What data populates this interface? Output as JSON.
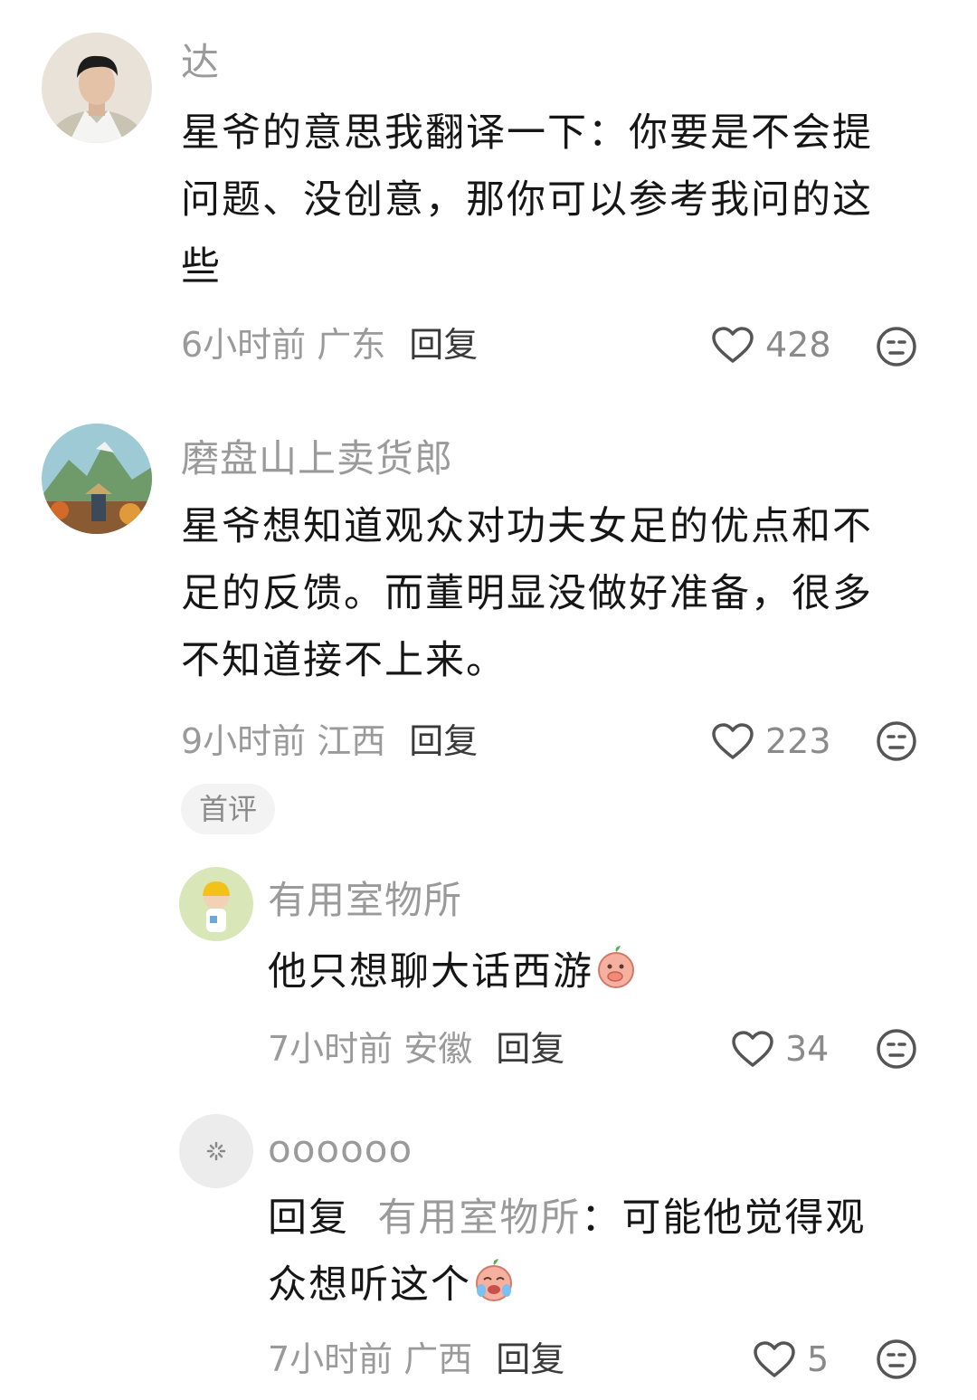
{
  "comments": [
    {
      "author": "达",
      "lines": [
        "星爷的意思我翻译一下：你要是不会提",
        "问题、没创意，那你可以参考我问的这",
        "些"
      ],
      "time_location": "6小时前 广东",
      "reply_label": "回复",
      "likes": "428"
    },
    {
      "author": "磨盘山上卖货郎",
      "lines": [
        "星爷想知道观众对功夫女足的优点和不",
        "足的反馈。而董明显没做好准备，很多",
        "不知道接不上来。"
      ],
      "time_location": "9小时前 江西",
      "reply_label": "回复",
      "likes": "223",
      "tag": "首评"
    }
  ],
  "replies": [
    {
      "author": "有用室物所",
      "text": "他只想聊大话西游",
      "emoji": "covering-mouth-peach-emoji",
      "time_location": "7小时前 安徽",
      "reply_label": "回复",
      "likes": "34"
    },
    {
      "author": "oooooo",
      "reply_prefix": "回复",
      "reply_target": "有用室物所",
      "line1_rest": "：可能他觉得观",
      "line2": "众想听这个",
      "emoji": "crying-peach-emoji",
      "time_location": "7小时前 广西",
      "reply_label": "回复",
      "likes": "5"
    }
  ],
  "colors": {
    "muted_text": "#9a9a9a",
    "body_text": "#161616",
    "tag_bg": "#f3f3f3"
  }
}
